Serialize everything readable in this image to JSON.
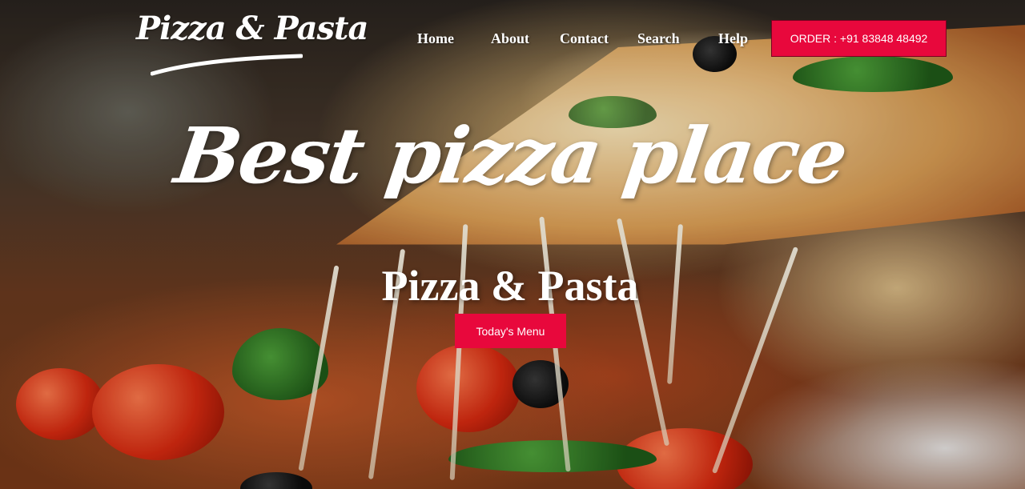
{
  "logo": {
    "text": "Pizza & Pasta"
  },
  "nav": {
    "items": [
      {
        "label": "Home"
      },
      {
        "label": "About"
      },
      {
        "label": "Contact"
      },
      {
        "label": "Search"
      },
      {
        "label": "Help"
      }
    ]
  },
  "order_button": {
    "label": "ORDER : +91 83848 48492",
    "color": "#e8083c"
  },
  "hero": {
    "headline": "Best pizza place",
    "subheadline": "Pizza & Pasta",
    "menu_button_label": "Today's Menu"
  },
  "colors": {
    "accent": "#e8083c",
    "text": "#ffffff"
  }
}
